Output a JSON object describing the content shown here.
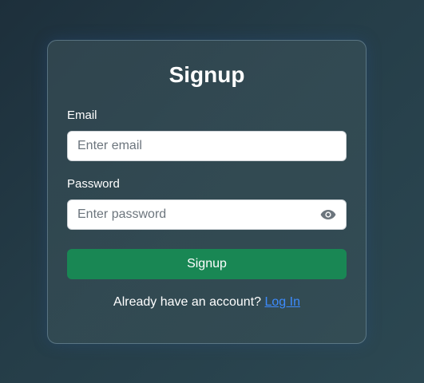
{
  "form": {
    "title": "Signup",
    "email_label": "Email",
    "email_placeholder": "Enter email",
    "email_value": "",
    "password_label": "Password",
    "password_placeholder": "Enter password",
    "password_value": "",
    "password_toggle_icon": "eye-icon",
    "submit_label": "Signup",
    "footer_text": "Already have an account?",
    "login_link_label": "Log In"
  },
  "colors": {
    "primary_button": "#198754",
    "link": "#3d8bfd",
    "card_border": "#8caabe"
  }
}
